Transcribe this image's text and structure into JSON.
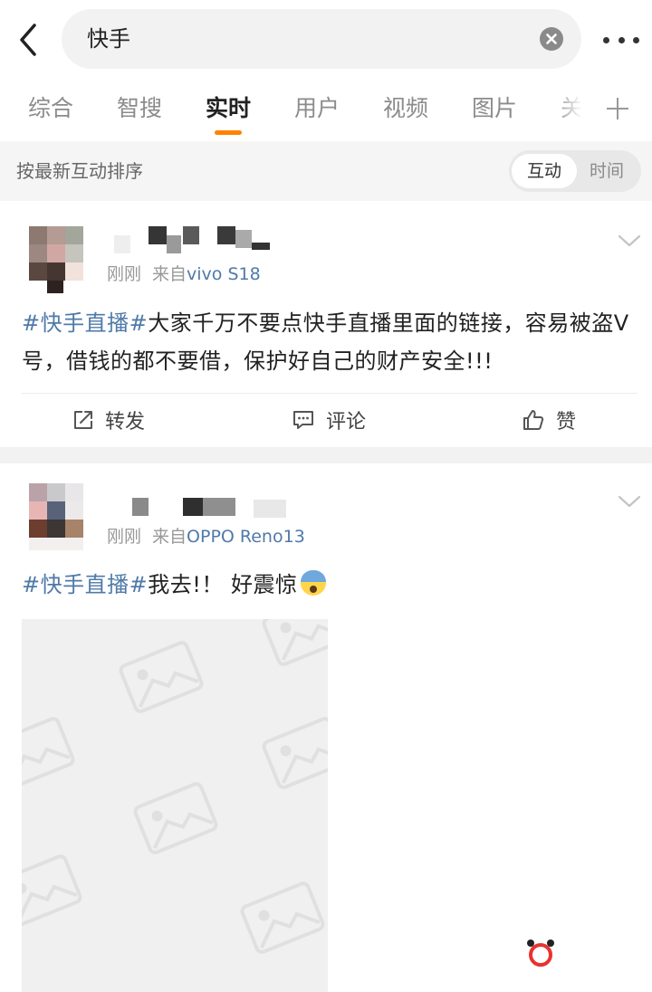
{
  "search": {
    "query": "快手"
  },
  "tabs": [
    {
      "label": "综合"
    },
    {
      "label": "智搜"
    },
    {
      "label": "实时"
    },
    {
      "label": "用户"
    },
    {
      "label": "视频"
    },
    {
      "label": "图片"
    },
    {
      "label": "关"
    }
  ],
  "active_tab": "实时",
  "sort": {
    "label": "按最新互动排序",
    "options": [
      "互动",
      "时间"
    ],
    "selected": "互动"
  },
  "posts": [
    {
      "time": "刚刚",
      "source_prefix": "来自",
      "device": "vivo S18",
      "tag": "#快手直播#",
      "text": "大家千万不要点快手直播里面的链接，容易被盗Ⅴ号，借钱的都不要借，保护好自己的财产安全!!!",
      "actions": {
        "repost": "转发",
        "comment": "评论",
        "like": "赞"
      }
    },
    {
      "time": "刚刚",
      "source_prefix": "来自",
      "device": "OPPO Reno13",
      "tag": "#快手直播#",
      "text": "我去!！ 好震惊",
      "emoji": "fearful-face-icon"
    }
  ],
  "colors": {
    "accent": "#ff8200",
    "link": "#4f7aa8"
  }
}
